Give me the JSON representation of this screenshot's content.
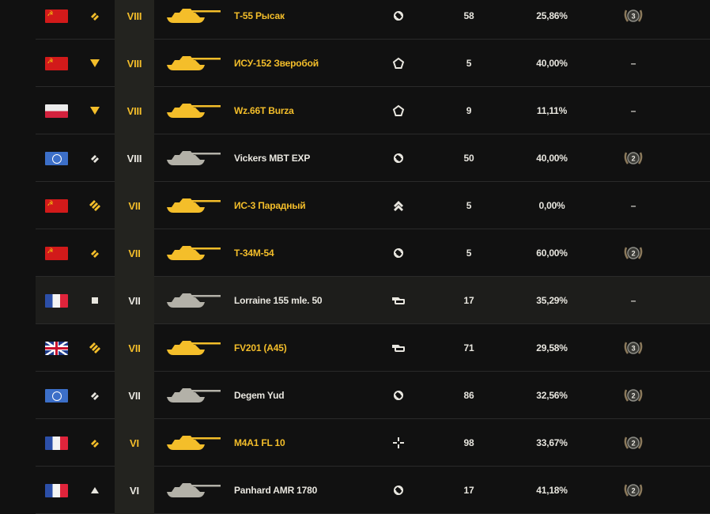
{
  "colors": {
    "background": "#111111",
    "row_alt": "#1d1d1b",
    "gold": "#f4be2a",
    "normal": "#b3b1a8"
  },
  "rows": [
    {
      "nation": "ussr",
      "rank_icon": "double-chevron-icon",
      "rank_color": "gold",
      "tier": "VIII",
      "tier_gold": true,
      "tank_color": "gold",
      "name": "Т-55 Рысак",
      "name_gold": true,
      "role_icon": "universal-role-icon",
      "battles": "58",
      "winrate": "25,86%",
      "mastery": "3"
    },
    {
      "nation": "ussr",
      "rank_icon": "down-triangle-icon",
      "rank_color": "gold",
      "tier": "VIII",
      "tier_gold": true,
      "tank_color": "gold",
      "name": "ИСУ-152 Зверобой",
      "name_gold": true,
      "role_icon": "pentagon-role-icon",
      "battles": "5",
      "winrate": "40,00%",
      "mastery": "–"
    },
    {
      "nation": "poland",
      "rank_icon": "down-triangle-icon",
      "rank_color": "gold",
      "tier": "VIII",
      "tier_gold": true,
      "tank_color": "gold",
      "name": "Wz.66T Burza",
      "name_gold": true,
      "role_icon": "pentagon-role-icon",
      "battles": "9",
      "winrate": "11,11%",
      "mastery": "–"
    },
    {
      "nation": "un",
      "rank_icon": "double-chevron-icon",
      "rank_color": "white",
      "tier": "VIII",
      "tier_gold": false,
      "tank_color": "gray",
      "name": "Vickers MBT EXP",
      "name_gold": false,
      "role_icon": "universal-role-icon",
      "battles": "50",
      "winrate": "40,00%",
      "mastery": "2"
    },
    {
      "nation": "ussr",
      "rank_icon": "triple-chevron-icon",
      "rank_color": "gold",
      "tier": "VII",
      "tier_gold": true,
      "tank_color": "gold",
      "name": "ИС-3 Парадный",
      "name_gold": true,
      "role_icon": "assault-role-icon",
      "battles": "5",
      "winrate": "0,00%",
      "mastery": "–"
    },
    {
      "nation": "ussr",
      "rank_icon": "double-chevron-icon",
      "rank_color": "gold",
      "tier": "VII",
      "tier_gold": true,
      "tank_color": "gold",
      "name": "Т-34М-54",
      "name_gold": true,
      "role_icon": "universal-role-icon",
      "battles": "5",
      "winrate": "60,00%",
      "mastery": "2"
    },
    {
      "nation": "france",
      "rank_icon": "square-icon",
      "rank_color": "white",
      "tier": "VII",
      "tier_gold": false,
      "tank_color": "gray",
      "name": "Lorraine 155 mle. 50",
      "name_gold": false,
      "role_icon": "artillery-role-icon",
      "battles": "17",
      "winrate": "35,29%",
      "mastery": "–"
    },
    {
      "nation": "uk",
      "rank_icon": "triple-chevron-icon",
      "rank_color": "gold",
      "tier": "VII",
      "tier_gold": true,
      "tank_color": "gold",
      "name": "FV201 (A45)",
      "name_gold": true,
      "role_icon": "artillery-role-icon",
      "battles": "71",
      "winrate": "29,58%",
      "mastery": "3"
    },
    {
      "nation": "un",
      "rank_icon": "double-chevron-icon",
      "rank_color": "white",
      "tier": "VII",
      "tier_gold": false,
      "tank_color": "gray",
      "name": "Degem Yud",
      "name_gold": false,
      "role_icon": "universal-role-icon",
      "battles": "86",
      "winrate": "32,56%",
      "mastery": "2"
    },
    {
      "nation": "france",
      "rank_icon": "double-chevron-icon",
      "rank_color": "gold",
      "tier": "VI",
      "tier_gold": true,
      "tank_color": "gold",
      "name": "M4A1 FL 10",
      "name_gold": true,
      "role_icon": "crosshair-role-icon",
      "battles": "98",
      "winrate": "33,67%",
      "mastery": "2"
    },
    {
      "nation": "france",
      "rank_icon": "triangle-up-icon",
      "rank_color": "white",
      "tier": "VI",
      "tier_gold": false,
      "tank_color": "gray",
      "name": "Panhard AMR 1780",
      "name_gold": false,
      "role_icon": "universal-role-icon",
      "battles": "17",
      "winrate": "41,18%",
      "mastery": "2"
    }
  ]
}
